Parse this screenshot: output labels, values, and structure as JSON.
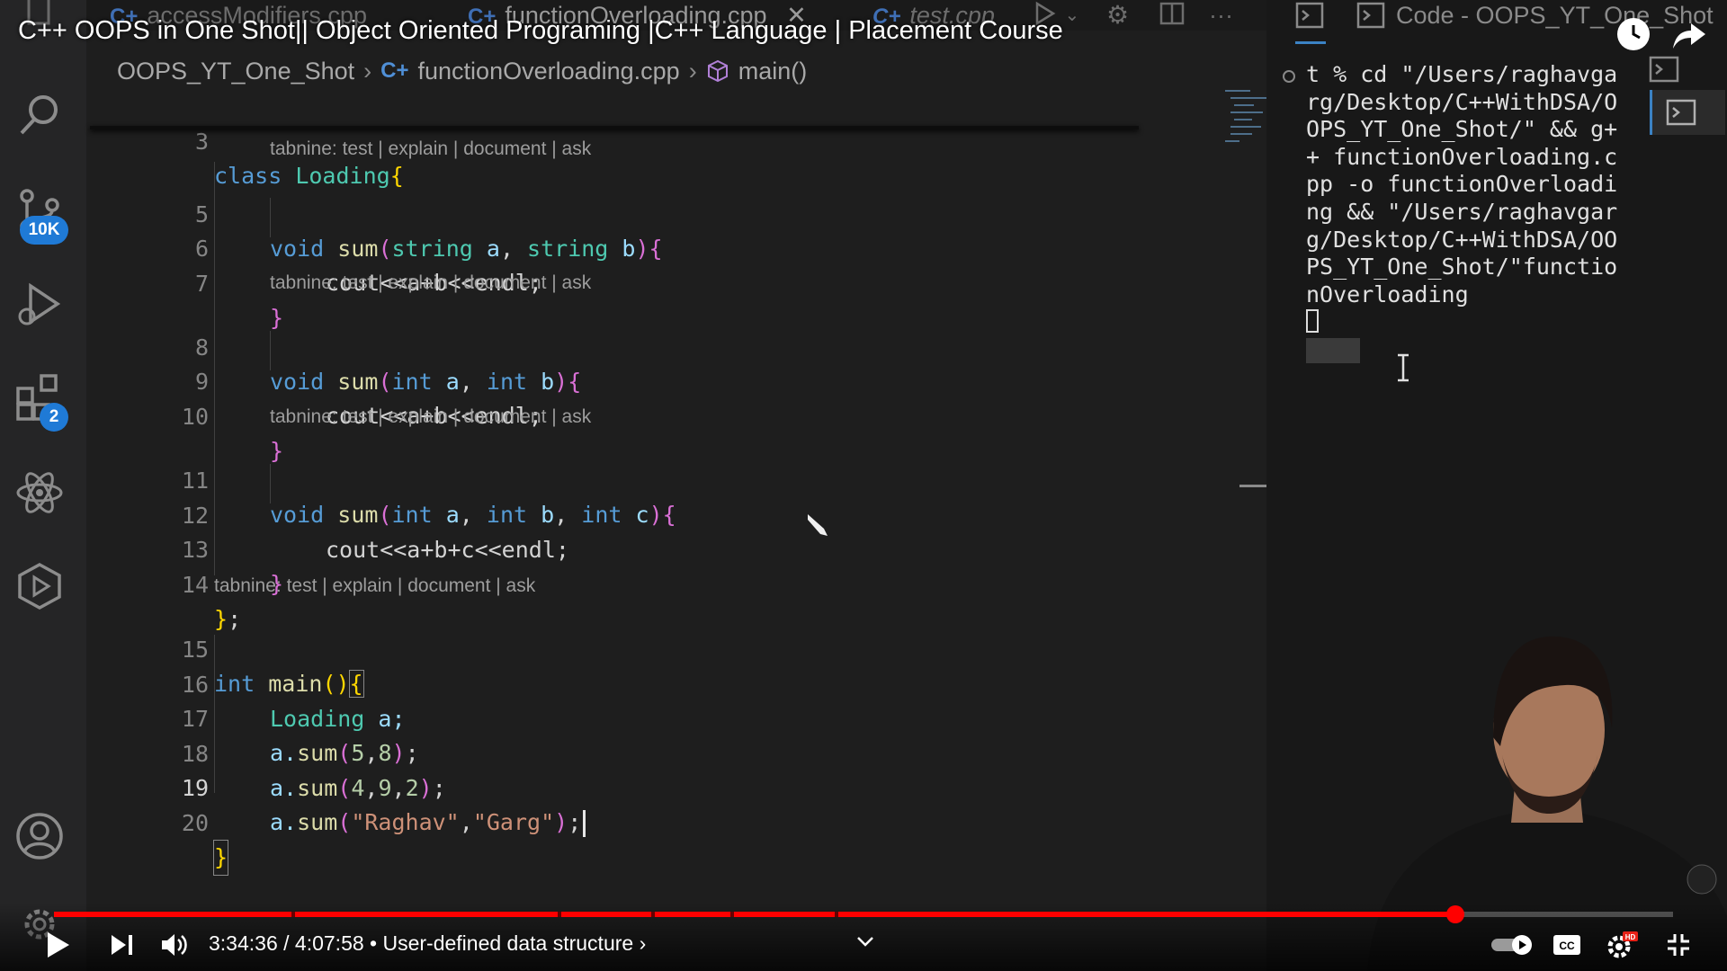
{
  "video": {
    "title": "C++ OOPS in One Shot|| Object Oriented Programing |C++ Language | Placement Course",
    "time": "3:34:36 / 4:07:58",
    "chapter": "• User-defined data structure ›",
    "progress": 0.8656
  },
  "activity_bar": {
    "source_control_badge": "10K",
    "extensions_badge": "2"
  },
  "tabs": [
    {
      "label": "accessModifiers.cpp",
      "icon": "cpp-icon"
    },
    {
      "label": "functionOverloading.cpp",
      "icon": "cpp-icon",
      "active": true
    },
    {
      "label": "test.cpp",
      "icon": "cpp-icon"
    }
  ],
  "breadcrumb": {
    "folder": "OOPS_YT_One_Shot",
    "file": "functionOverloading.cpp",
    "symbol": "main()"
  },
  "lens_text": "tabnine: test | explain | document | ask",
  "code": {
    "ln3": "3",
    "ln5": "5",
    "ln6": "6",
    "ln7": "7",
    "ln8": "8",
    "ln9": "9",
    "ln10": "10",
    "ln11": "11",
    "ln12": "12",
    "ln13": "13",
    "ln14": "14",
    "ln15": "15",
    "ln16": "16",
    "ln17": "17",
    "ln18": "18",
    "ln19": "19",
    "ln20": "20",
    "l3_kw": "class",
    "l3_name": "Loading",
    "l3_brace": "{",
    "l5_void": "void",
    "l5_fn": "sum",
    "l5_p1": "(",
    "l5_t1": "string",
    "l5_a": "a",
    "l5_comma": ", ",
    "l5_t2": "string",
    "l5_b": "b",
    "l5_p2": ")",
    "l5_brace": "{",
    "l6": "cout<<a+b<<endl;",
    "l7": "}",
    "l8_void": "void",
    "l8_fn": "sum",
    "l8_p1": "(",
    "l8_t1": "int",
    "l8_a": "a",
    "l8_comma": ", ",
    "l8_t2": "int",
    "l8_b": "b",
    "l8_p2": ")",
    "l8_brace": "{",
    "l9": "cout<<a+b<<endl;",
    "l10": "}",
    "l11_void": "void",
    "l11_fn": "sum",
    "l11_p1": "(",
    "l11_t1": "int",
    "l11_a": "a",
    "l11_c1": ", ",
    "l11_t2": "int",
    "l11_b": "b",
    "l11_c2": ", ",
    "l11_t3": "int",
    "l11_c": "c",
    "l11_p2": ")",
    "l11_brace": "{",
    "l12": "cout<<a+b+c<<endl;",
    "l13": "}",
    "l14_brace": "}",
    "l14_semi": ";",
    "l15_kw": "int",
    "l15_fn": "main",
    "l15_parens": "()",
    "l15_brace": "{",
    "l16_type": "Loading",
    "l16_rest": " a;",
    "l17_obj": "a.",
    "l17_fn": "sum",
    "l17_p1": "(",
    "l17_n1": "5",
    "l17_comma": ",",
    "l17_n2": "8",
    "l17_p2": ")",
    "l17_semi": ";",
    "l18_obj": "a.",
    "l18_fn": "sum",
    "l18_p1": "(",
    "l18_n1": "4",
    "l18_c1": ",",
    "l18_n2": "9",
    "l18_c2": ",",
    "l18_n3": "2",
    "l18_p2": ")",
    "l18_semi": ";",
    "l19_obj": "a.",
    "l19_fn": "sum",
    "l19_p1": "(",
    "l19_s1": "\"Raghav\"",
    "l19_comma": ",",
    "l19_s2": "\"Garg\"",
    "l19_p2": ")",
    "l19_semi": ";",
    "l20": "}"
  },
  "terminal": {
    "title": "Code - OOPS_YT_One_Shot",
    "output": "t % cd \"/Users/raghavgarg/Desktop/C++WithDSA/OOPS_YT_One_Shot/\" && g++ functionOverloading.cpp -o functionOverloading && \"/Users/raghavgarg/Desktop/C++WithDSA/OOPS_YT_One_Shot/\"functionOverloading"
  },
  "colors": {
    "accent_red": "#ff0000",
    "badge_blue": "#1f7ad6",
    "editor_bg": "#1e1e1e"
  }
}
